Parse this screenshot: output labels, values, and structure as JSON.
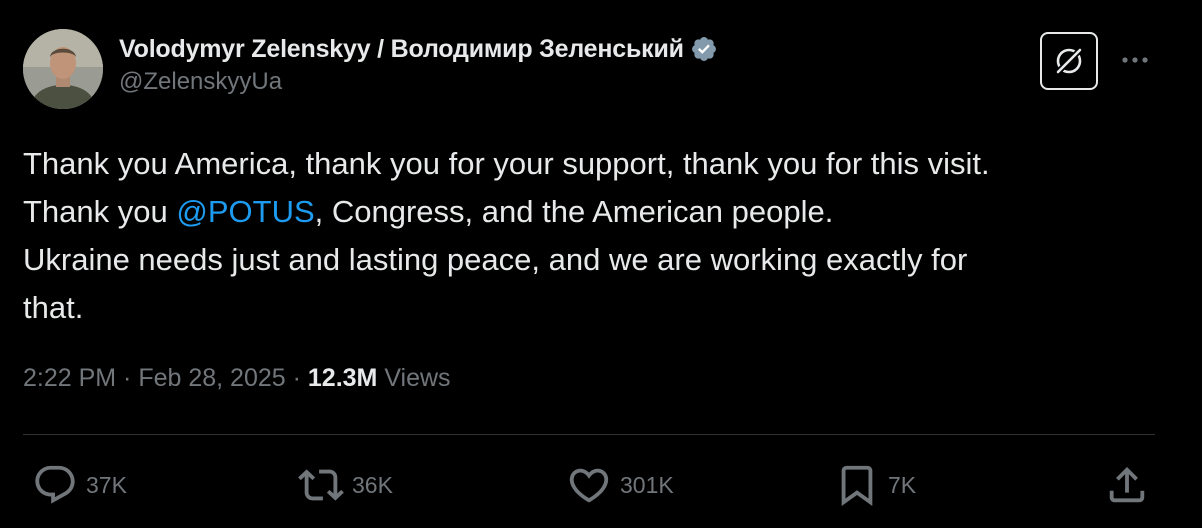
{
  "tweet": {
    "author": {
      "display_name": "Volodymyr Zelenskyy / Володимир Зеленський",
      "handle": "@ZelenskyyUa",
      "verified": true
    },
    "body": {
      "line1": "Thank you America, thank you for your support, thank you for this visit.",
      "line2_prefix": "Thank you ",
      "mention": "@POTUS",
      "line2_suffix": ", Congress, and the American people.",
      "line3": "Ukraine needs just and lasting peace, and we are working exactly for",
      "line4": "that."
    },
    "meta": {
      "time": "2:22 PM",
      "separator": " · ",
      "date": "Feb 28, 2025",
      "views_count": "12.3M",
      "views_label": " Views"
    },
    "actions": {
      "replies": "37K",
      "reposts": "36K",
      "likes": "301K",
      "bookmarks": "7K"
    }
  },
  "icons": {
    "verified": "verified-badge-icon",
    "grok": "grok-icon",
    "more": "more-icon",
    "reply": "reply-icon",
    "repost": "repost-icon",
    "like": "heart-icon",
    "bookmark": "bookmark-icon",
    "share": "share-icon"
  },
  "colors": {
    "background": "#000000",
    "text_primary": "#e7e9ea",
    "text_secondary": "#71767b",
    "link": "#1d9bf0",
    "divider": "#2f3336",
    "verified_badge": "#829aab"
  }
}
